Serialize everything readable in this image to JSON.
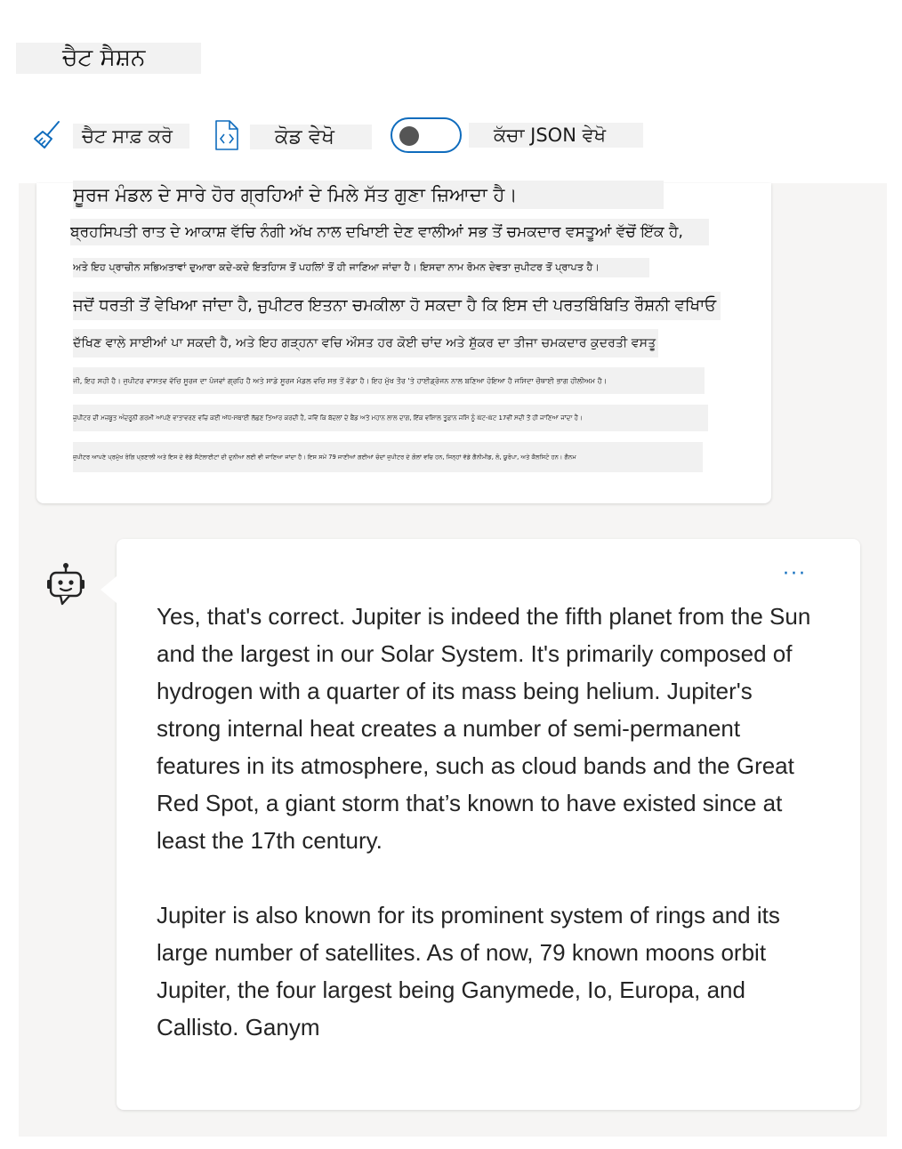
{
  "header": {
    "session_title": "ਚੈਟ ਸੈਸ਼ਨ"
  },
  "toolbar": {
    "clear_chat_label": "ਚੈਟ ਸਾਫ਼ ਕਰੋ",
    "clear_chat_icon": "broom-icon",
    "view_code_label": "ਕੋਡ ਵੇਖੋ",
    "view_code_icon": "code-file-icon",
    "raw_json_toggle_on": false,
    "raw_json_label": "ਕੱਚਾ JSON ਵੇਖੋ"
  },
  "user_message": {
    "lines": [
      "ਸੂਰਜ ਮੰਡਲ ਦੇ ਸਾਰੇ ਹੋਰ ਗ੍ਰਹਿਆਂ ਦੇ ਮਿਲੇ ਸੱਤ ਗੁਣਾ ਜ਼ਿਆਦਾ ਹੈ।",
      "ਬ੍ਰਹਸਿਪਤੀ ਰਾਤ ਦੇ ਆਕਾਸ਼ ਵੱਚਿ ਨੰਗੀ ਅੱਖ ਨਾਲ ਦਖਿਾਈ ਦੇਣ ਵਾਲੀਆਂ ਸਭ ਤੋਂ ਚਮਕਦਾਰ ਵਸਤੂਆਂ ਵੱਚੋਂ ਇੱਕ ਹੈ,",
      "ਅਤੇ ਇਹ ਪ੍ਰਾਚੀਨ ਸਭਿਅਤਾਵਾਂ ਦੁਆਰਾ ਕਦੇ-ਕਦੇ ਇਤਹਿਾਸ ਤੋਂ ਪਹਲਿਾਂ ਤੋਂ ਹੀ ਜਾਣਿਆ ਜਾਂਦਾ ਹੈ। ਇਸਦਾ ਨਾਮ ਰੋਮਨ ਦੇਵਤਾ ਜੁਪੀਟਰ ਤੋਂ ਪ੍ਰਾਪਤ ਹੈ।",
      "ਜਦੋਂ ਧਰਤੀ ਤੋਂ ਵੇਖਿਆ ਜਾਂਦਾ ਹੈ, ਜੁਪੀਟਰ ਇਤਨਾ ਚਮਕੀਲਾ ਹੋ ਸਕਦਾ ਹੈ ਕਿ ਇਸ ਦੀ ਪਰਤਬਿੰਬਿਤਿ ਰੌਸ਼ਨੀ ਵਖਿਾਓ",
      "ਦੱਖਿਣ ਵਾਲੇ ਸਾਈਆਂ ਪਾ ਸਕਦੀ ਹੈ, ਅਤੇ ਇਹ ਗੜ੍ਹਨਾ ਵਚਿ ਔਸਤ ਹਰ ਕੋਈ ਚਾਂਦ ਅਤੇ ਸ਼ੁੱਕਰ ਦਾ ਤੀਜਾ ਚਮਕਦਾਰ ਕੁਦਰਤੀ ਵਸਤੂ ਹੈ।",
      "ਜੀ, ਇਹ ਸਹੀ ਹੈ। ਜੁਪੀਟਰ ਵਾਸਤਵ ਵੱਚਿ ਸੂਰਜ ਦਾ ਪੰਜਵਾਂ ਗ੍ਰਹਿ ਹੈ ਅਤੇ ਸਾਡੇ ਸੂਰਜ ਮੰਡਲ ਵਚਿ ਸਭ ਤੋਂ ਵੱਡਾ ਹੈ। ਇਹ ਮੁੱਖ ਤੌਰ 'ਤੇ ਹਾਈਡ੍ਰੋਜਨ ਨਾਲ ਬਣਿਆ ਹੋਇਆ ਹੈ ਜਸਿਦਾ ਚੌਥਾਈ ਭਾਗ ਹੀਲੀਅਮ ਹੈ।",
      "ਜੁਪੀਟਰ ਦੀ ਮਜ਼ਬੂਤ ਅੰਦਰੂਨੀ ਗਰਮੀ ਆਪਣੇ ਵਾਤਾਵਰਣ ਵਚਿ ਕਈ ਅੱਧ-ਸਥਾਈ ਲੱਛਣ ਤਿਆਰ ਕਰਦੀ ਹੈ, ਜਵਿੇਂ ਕਿ ਬੱਦਲਾਂ ਦੇ ਬੈਂਡ ਅਤੇ ਮਹਾਨ ਲਾਲ ਦਾਗ, ਇੱਕ ਵਸ਼ਿਾਲ ਤੂਫ਼ਾਨ ਜਸਿ ਨੂੰ ਘੱਟ-ਘੱਟ 17ਵੀਂ ਸਦੀ ਤੋਂ ਹੀ ਜਾਣਿਆ ਜਾਂਦਾ ਹੈ।",
      "ਜੁਪੀਟਰ ਆਪਣੇ ਪ੍ਰਮੁੱਖ ਰੰਗਿ ਪ੍ਰਣਾਲੀ ਅਤੇ ਇਸ ਦੇ ਵੱਡੇ ਸੈਟੇਲਾਈਟਾਂ ਦੀ ਦੁਨੀਆ ਲਈ ਵੀ ਜਾਣਿਆ ਜਾਂਦਾ ਹੈ। ਇਸ ਸਮੇਂ 79 ਜਾਣੀਆਂ ਗਈਆਂ ਚੰਦਾਂ ਜੁਪੀਟਰ ਦੇ ਗੋਲਾਂ ਵਚਿ ਹਨ, ਜਿਨ੍ਹਾਂ ਵੱਡੇ ਗੈਨੀਮੀਡ, ਲੋ, ਯੂਰੋਪਾ, ਅਤੇ ਕੈਲਸਿਟੋ ਹਨ। ਗੈਨਮ"
    ]
  },
  "assistant_message": {
    "avatar_icon": "bot-icon",
    "more_options_icon": "ellipsis-icon",
    "paragraphs": [
      "Yes, that's correct. Jupiter is indeed the fifth planet from the Sun and the largest in our Solar System. It's primarily composed of hydrogen with a quarter of its mass being helium. Jupiter's strong internal heat creates a number of semi-permanent features in its atmosphere, such as cloud bands and the Great Red Spot, a giant storm that’s known to have existed since at least the 17th century.",
      "Jupiter is also known for its prominent system of rings and its large number of satellites. As of now, 79 known moons orbit Jupiter, the four largest being Ganymede, Io, Europa, and Callisto. Ganym"
    ]
  },
  "colors": {
    "accent": "#0f6cbd",
    "chat_background": "#f6f5f4",
    "label_background": "#f2f2f2"
  }
}
